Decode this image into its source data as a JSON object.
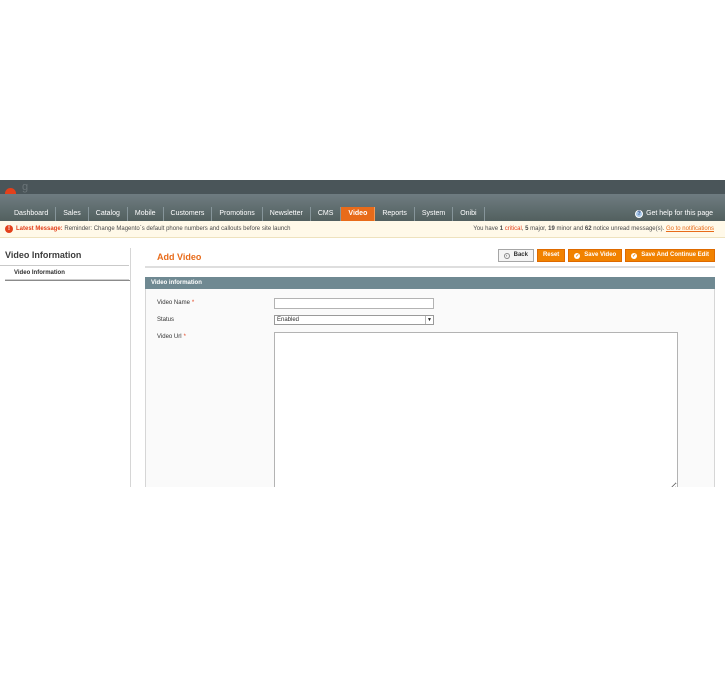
{
  "header": {
    "logo_text": "g"
  },
  "nav": {
    "items": [
      "Dashboard",
      "Sales",
      "Catalog",
      "Mobile",
      "Customers",
      "Promotions",
      "Newsletter",
      "CMS",
      "Video",
      "Reports",
      "System",
      "Onibi"
    ],
    "active": "Video",
    "help_label": "Get help for this page"
  },
  "notice": {
    "latest_label": "Latest Message:",
    "message": "Reminder: Change Magento`s default phone numbers and callouts before site launch",
    "summary_prefix": "You have",
    "critical_count": "1",
    "critical_label": "critical",
    "major_count": "5",
    "major_label": "major,",
    "minor_count": "19",
    "minor_label": "minor and",
    "notice_count": "62",
    "notice_label": "notice unread message(s).",
    "link_label": "Go to notifications"
  },
  "sidebar": {
    "title": "Video Information",
    "tab_label": "Video Information"
  },
  "content": {
    "title": "Add Video",
    "buttons": {
      "back": "Back",
      "reset": "Reset",
      "save": "Save Video",
      "save_continue": "Save And Continue Edit"
    }
  },
  "form": {
    "section_title": "Video information",
    "fields": {
      "video_name_label": "Video Name",
      "video_name_value": "",
      "status_label": "Status",
      "status_value": "Enabled",
      "video_url_label": "Video Url",
      "video_url_value": "",
      "required_mark": "*"
    }
  },
  "colors": {
    "accent": "#e86b1a",
    "header_bg": "#4a5559",
    "section_head": "#6f8992"
  }
}
